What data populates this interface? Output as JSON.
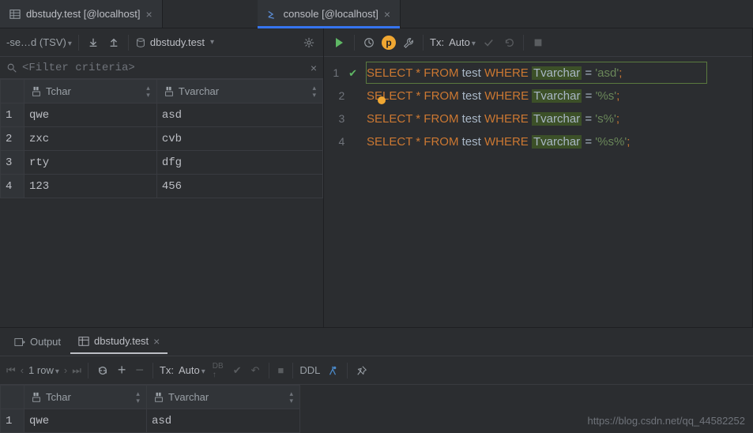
{
  "tabs": {
    "left": {
      "label": "dbstudy.test [@localhost]"
    },
    "right": {
      "label": "console [@localhost]"
    }
  },
  "leftToolbar": {
    "format": "-se…d (TSV)",
    "datasource": "dbstudy.test"
  },
  "filter": {
    "placeholder": "<Filter criteria>"
  },
  "topTable": {
    "columns": [
      {
        "name": "Tchar"
      },
      {
        "name": "Tvarchar"
      }
    ],
    "rows": [
      {
        "n": "1",
        "c0": "qwe",
        "c1": "asd"
      },
      {
        "n": "2",
        "c0": "zxc",
        "c1": "cvb"
      },
      {
        "n": "3",
        "c0": "rty",
        "c1": "dfg"
      },
      {
        "n": "4",
        "c0": "123",
        "c1": "456"
      }
    ]
  },
  "txLabel": "Tx:",
  "txMode": "Auto",
  "editor": {
    "kw_select": "SELECT",
    "kw_from": "FROM",
    "kw_where": "WHERE",
    "star": "*",
    "table": "test",
    "col": "Tvarchar",
    "eq": "=",
    "lines": [
      {
        "n": "1",
        "lit": "'asd'"
      },
      {
        "n": "2",
        "lit": "'%s'"
      },
      {
        "n": "3",
        "lit": "'s%'"
      },
      {
        "n": "4",
        "lit": "'%s%'"
      }
    ]
  },
  "bottom": {
    "outputLabel": "Output",
    "resultLabel": "dbstudy.test",
    "rowCount": "1 row",
    "ddl": "DDL",
    "table": {
      "columns": [
        {
          "name": "Tchar"
        },
        {
          "name": "Tvarchar"
        }
      ],
      "rows": [
        {
          "n": "1",
          "c0": "qwe",
          "c1": "asd"
        }
      ]
    }
  },
  "watermark": "https://blog.csdn.net/qq_44582252"
}
